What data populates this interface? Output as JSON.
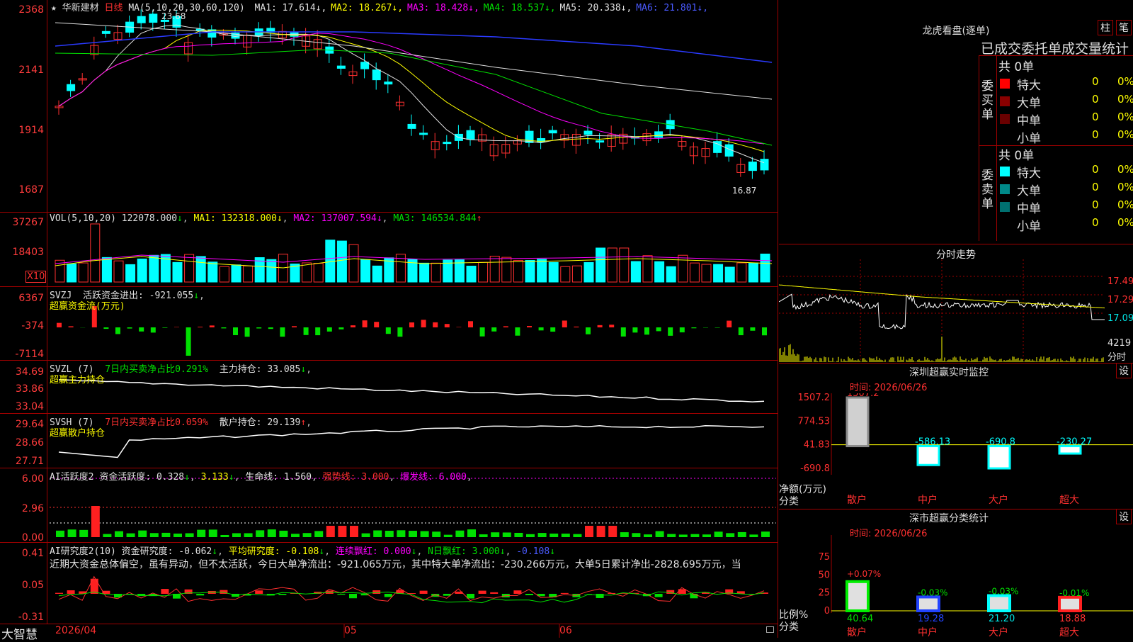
{
  "stock": {
    "name": "华新建材",
    "period": "日线"
  },
  "main_chart": {
    "ma_label": "MA(5,10,20,30,60,120)",
    "ma": [
      {
        "name": "MA1",
        "value": "17.614",
        "color": "#e0e0e0"
      },
      {
        "name": "MA2",
        "value": "18.267",
        "color": "#ffff00"
      },
      {
        "name": "MA3",
        "value": "18.428",
        "color": "#ff00ff"
      },
      {
        "name": "MA4",
        "value": "18.537",
        "color": "#00e000"
      },
      {
        "name": "MA5",
        "value": "20.338",
        "color": "#e0e0e0"
      },
      {
        "name": "MA6",
        "value": "21.801",
        "color": "#4a5aff"
      }
    ],
    "y_ticks": [
      "2368",
      "2141",
      "1914",
      "1687"
    ],
    "high_label": "23.68",
    "low_label": "16.87"
  },
  "vol": {
    "label": "VOL(5,10,20)",
    "value": "122078.000",
    "ma": [
      {
        "name": "MA1",
        "value": "132318.000"
      },
      {
        "name": "MA2",
        "value": "137007.594"
      },
      {
        "name": "MA3",
        "value": "146534.844"
      }
    ],
    "y_ticks": [
      "37267",
      "18403"
    ],
    "unit": "X10"
  },
  "svzj": {
    "label": "SVZJ",
    "text": "活跃资金进出: -921.055",
    "sub": "超赢资金流(万元)",
    "y_ticks": [
      "6367",
      "-374",
      "-7114"
    ]
  },
  "svzl": {
    "label": "SVZL (7)",
    "text1": "7日内买卖净占比0.291%",
    "text2": "主力持仓: 33.085",
    "sub": "超赢主力持仓",
    "y_ticks": [
      "34.69",
      "33.86",
      "33.04"
    ]
  },
  "svsh": {
    "label": "SVSH (7)",
    "text1": "7日内买卖净占比0.059%",
    "text2": "散户持仓: 29.139",
    "sub": "超赢散户持仓",
    "y_ticks": [
      "29.64",
      "28.66",
      "27.71"
    ]
  },
  "ai_active": {
    "label": "AI活跃度2",
    "t1": "资金活跃度: 0.328",
    "t2": "3.133",
    "t3": "生命线: 1.560",
    "t4": "强势线: 3.000",
    "t5": "爆发线: 6.000",
    "y_ticks": [
      "6.00",
      "2.96",
      "0.00"
    ]
  },
  "ai_research": {
    "label": "AI研究度2(10)",
    "t1": "资金研究度: -0.062",
    "t2": "平均研究度: -0.108",
    "t3": "连续飘红: 0.000",
    "t4": "N日飘红: 3.000",
    "t5": "-0.108",
    "comment": "近期大资金总体偏空，虽有异动，但不太活跃，今日大单净流出：-921.065万元，其中特大单净流出：-230.266万元，大单5日累计净出-2828.695万元，当",
    "y_ticks": [
      "0.41",
      "0.05",
      "-0.31"
    ]
  },
  "x_axis": [
    "2026/04",
    "05",
    "06"
  ],
  "brand": "大智慧",
  "longhu": {
    "title": "龙虎看盘(逐单)",
    "btn1": "柱",
    "btn2": "笔",
    "header": "已成交委托单成交量统计",
    "buy": {
      "side": "委买单",
      "total": "共 0单",
      "rows": [
        {
          "label": "特大",
          "count": "0",
          "pct": "0%",
          "color": "#ff0000"
        },
        {
          "label": "大单",
          "count": "0",
          "pct": "0%",
          "color": "#8a0000"
        },
        {
          "label": "中单",
          "count": "0",
          "pct": "0%",
          "color": "#6a0000"
        },
        {
          "label": "小单",
          "count": "0",
          "pct": "0%",
          "color": ""
        }
      ]
    },
    "sell": {
      "side": "委卖单",
      "total": "共 0单",
      "rows": [
        {
          "label": "特大",
          "count": "0",
          "pct": "0%",
          "color": "#00ffff"
        },
        {
          "label": "大单",
          "count": "0",
          "pct": "0%",
          "color": "#008a8a"
        },
        {
          "label": "中单",
          "count": "0",
          "pct": "0%",
          "color": "#007070"
        },
        {
          "label": "小单",
          "count": "0",
          "pct": "0%",
          "color": ""
        }
      ]
    }
  },
  "intraday": {
    "title": "分时走势",
    "y_ticks": [
      "17.49",
      "17.29",
      "17.09"
    ],
    "vol_tick": "4219",
    "unit": "分时"
  },
  "monitor": {
    "title": "深圳超赢实时监控",
    "btn": "设",
    "time": "时间: 2026/06/26",
    "y_ticks": [
      "1507.2",
      "774.53",
      "41.83",
      "-690.8"
    ],
    "ylabel": "净额(万元)",
    "xlabel": "分类",
    "bars": [
      {
        "cat": "散户",
        "value": 1507.2,
        "label": "1507.2"
      },
      {
        "cat": "中户",
        "value": -586.13,
        "label": "-586.13"
      },
      {
        "cat": "大户",
        "value": -690.8,
        "label": "-690.8"
      },
      {
        "cat": "超大",
        "value": -230.27,
        "label": "-230.27"
      }
    ]
  },
  "classify": {
    "title": "深市超赢分类统计",
    "btn": "设",
    "time": "时间: 2026/06/26",
    "y_ticks": [
      "75",
      "50",
      "25",
      "0"
    ],
    "ylabel": "比例%",
    "xlabel": "分类",
    "bars": [
      {
        "cat": "散户",
        "value": 40.64,
        "change": "+0.07%",
        "color": "#00ee00"
      },
      {
        "cat": "中户",
        "value": 19.28,
        "change": "-0.03%",
        "color": "#2244ff"
      },
      {
        "cat": "大户",
        "value": 21.2,
        "change": "-0.03%",
        "color": "#00ffff"
      },
      {
        "cat": "超大",
        "value": 18.88,
        "change": "-0.01%",
        "color": "#ff2020"
      }
    ],
    "labels": [
      "40.64",
      "19.28",
      "21.20",
      "18.88"
    ]
  }
}
